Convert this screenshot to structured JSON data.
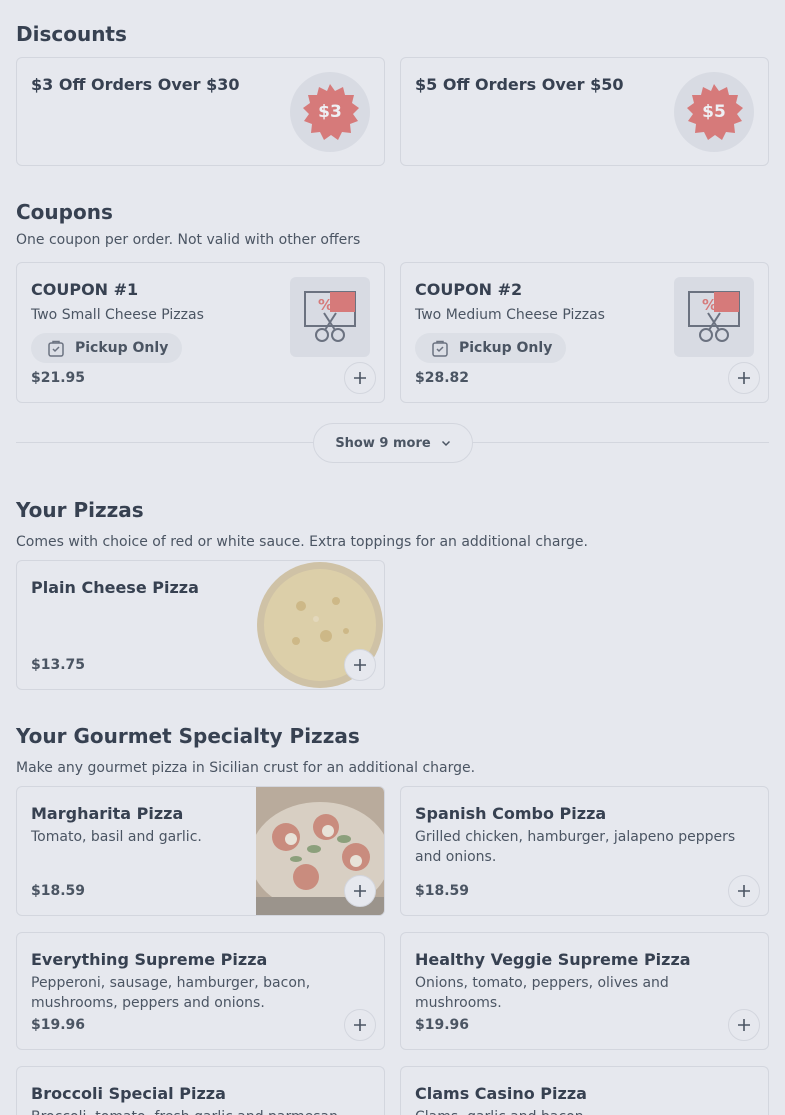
{
  "discounts": {
    "title": "Discounts",
    "items": [
      {
        "title": "$3 Off Orders Over $30",
        "badge": "$3"
      },
      {
        "title": "$5 Off Orders Over $50",
        "badge": "$5"
      }
    ]
  },
  "coupons": {
    "title": "Coupons",
    "subtitle": "One coupon per order. Not valid with other offers",
    "items": [
      {
        "title": "COUPON #1",
        "desc": "Two Small Cheese Pizzas",
        "chip": "Pickup Only",
        "price": "$21.95"
      },
      {
        "title": "COUPON #2",
        "desc": "Two Medium Cheese Pizzas",
        "chip": "Pickup Only",
        "price": "$28.82"
      }
    ],
    "show_more": "Show 9 more"
  },
  "your_pizzas": {
    "title": "Your Pizzas",
    "subtitle": "Comes with choice of red or white sauce. Extra toppings for an additional charge.",
    "items": [
      {
        "title": "Plain Cheese Pizza",
        "price": "$13.75"
      }
    ]
  },
  "gourmet": {
    "title": "Your Gourmet Specialty Pizzas",
    "subtitle": "Make any gourmet pizza in Sicilian crust for an additional charge.",
    "items": [
      {
        "title": "Margharita Pizza",
        "desc": "Tomato, basil and garlic.",
        "price": "$18.59"
      },
      {
        "title": "Spanish Combo Pizza",
        "desc": "Grilled chicken, hamburger, jalapeno peppers and onions.",
        "price": "$18.59"
      },
      {
        "title": "Everything Supreme Pizza",
        "desc": "Pepperoni, sausage, hamburger, bacon, mushrooms, peppers and onions.",
        "price": "$19.96"
      },
      {
        "title": "Healthy Veggie Supreme Pizza",
        "desc": "Onions, tomato, peppers, olives and mushrooms.",
        "price": "$19.96"
      },
      {
        "title": "Broccoli Special Pizza",
        "desc": "Broccoli, tomato, fresh garlic and parmesan."
      },
      {
        "title": "Clams Casino Pizza",
        "desc": "Clams, garlic and bacon."
      }
    ]
  },
  "colors": {
    "background": "#e6e8ee",
    "badge_red": "#d67a7a",
    "text": "#374151"
  }
}
